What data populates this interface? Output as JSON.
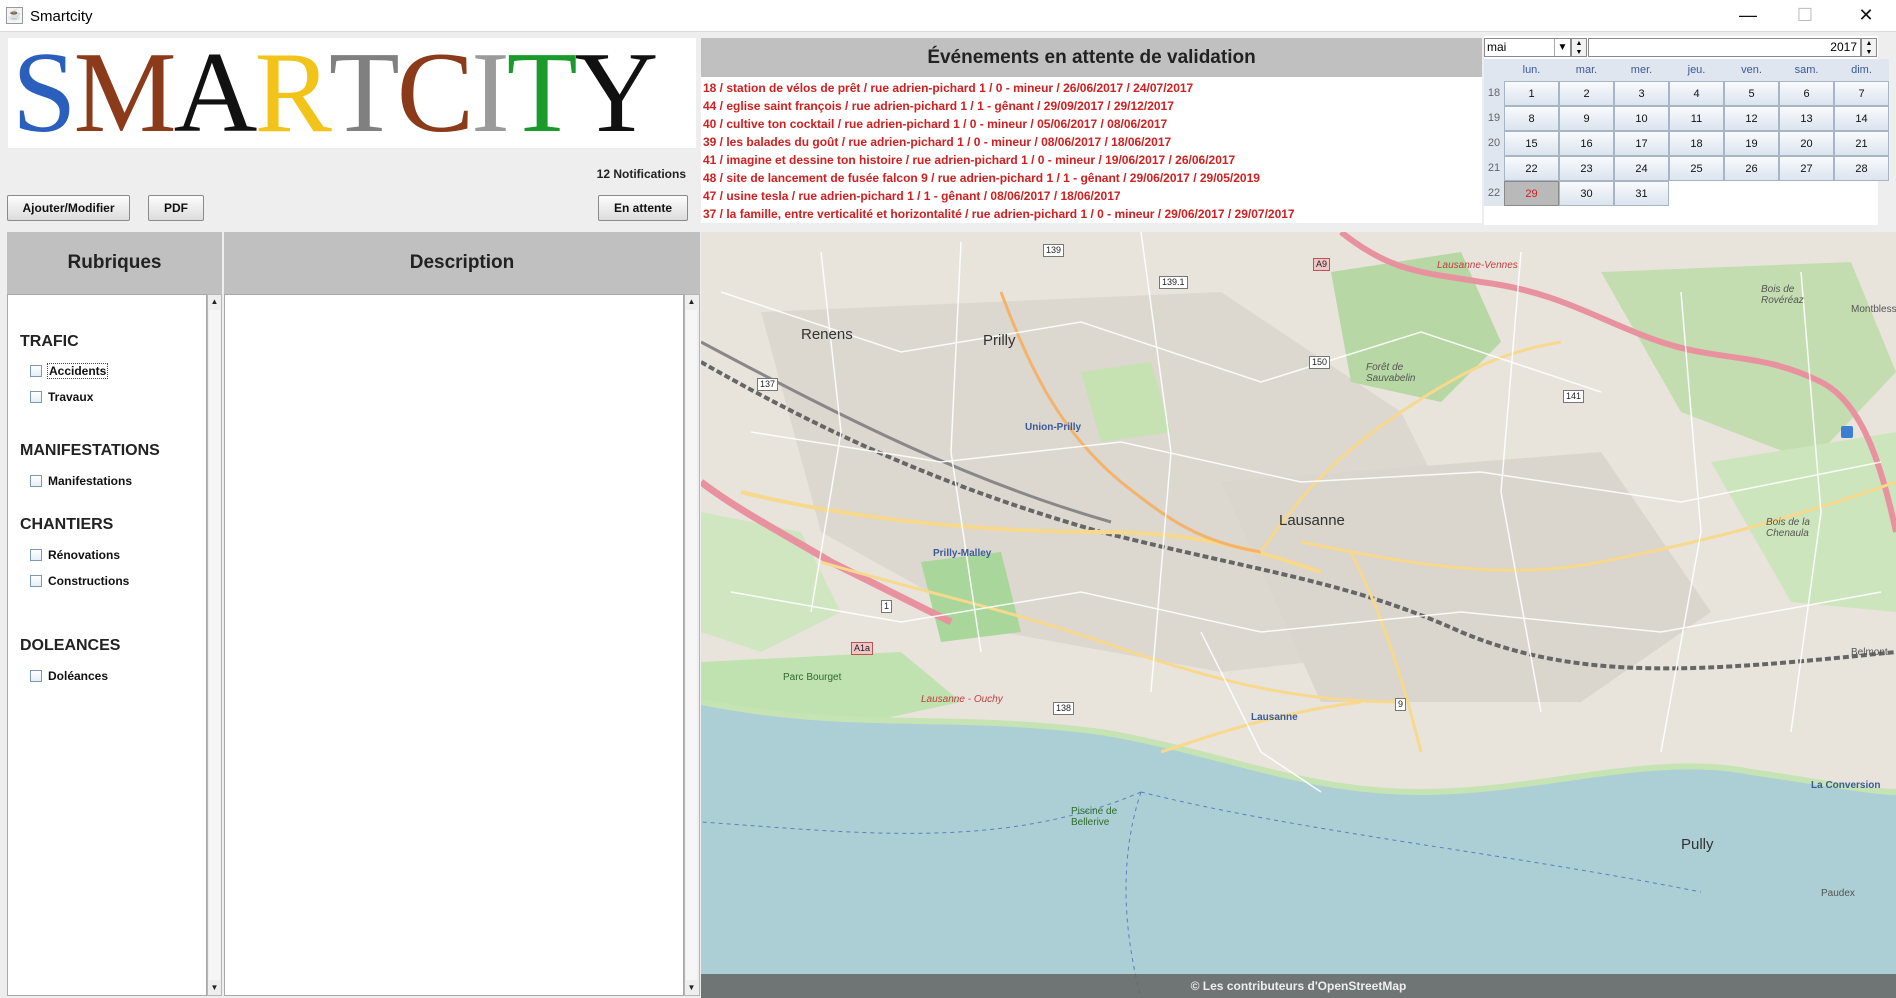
{
  "window": {
    "title": "Smartcity",
    "minimize_icon": "—",
    "maximize_icon": "☐",
    "close_icon": "✕"
  },
  "logo": {
    "letters": [
      {
        "char": "S",
        "color": "#2a5fbd"
      },
      {
        "char": "M",
        "color": "#8b3a1a"
      },
      {
        "char": "A",
        "color": "#111111"
      },
      {
        "char": "R",
        "color": "#f2c318"
      },
      {
        "char": "T",
        "color": "#808080"
      },
      {
        "char": "C",
        "color": "#8b3a1a"
      },
      {
        "char": "I",
        "color": "#9a9a9a"
      },
      {
        "char": "T",
        "color": "#1a9a2a"
      },
      {
        "char": "Y",
        "color": "#111111"
      }
    ]
  },
  "toolbar": {
    "notifications": "12 Notifications",
    "add_modify": "Ajouter/Modifier",
    "pdf": "PDF",
    "pending": "En attente"
  },
  "events": {
    "header": "Événements en attente de validation",
    "items": [
      "18 / station de vélos de prêt / rue adrien-pichard 1 / 0 - mineur / 26/06/2017 / 24/07/2017",
      "44 / eglise saint françois / rue adrien-pichard 1 / 1 - gênant / 29/09/2017 / 29/12/2017",
      "40 / cultive ton cocktail / rue adrien-pichard 1 / 0 - mineur / 05/06/2017 / 08/06/2017",
      "39 / les balades du goût  / rue adrien-pichard 1 / 0 - mineur / 08/06/2017 / 18/06/2017",
      "41 / imagine et dessine ton histoire / rue adrien-pichard 1 / 0 - mineur / 19/06/2017 / 26/06/2017",
      "48 / site de lancement de fusée falcon 9 / rue adrien-pichard 1 / 1 - gênant / 29/06/2017 / 29/05/2019",
      "47 / usine tesla / rue adrien-pichard 1 / 1 - gênant / 08/06/2017 / 18/06/2017",
      "37 / la famille, entre verticalité et horizontalité / rue adrien-pichard 1 / 0 - mineur / 29/06/2017 / 29/07/2017"
    ]
  },
  "calendar": {
    "month": "mai",
    "year": "2017",
    "weekdays": [
      "lun.",
      "mar.",
      "mer.",
      "jeu.",
      "ven.",
      "sam.",
      "dim."
    ],
    "weeks": [
      {
        "num": "18",
        "days": [
          "1",
          "2",
          "3",
          "4",
          "5",
          "6",
          "7"
        ]
      },
      {
        "num": "19",
        "days": [
          "8",
          "9",
          "10",
          "11",
          "12",
          "13",
          "14"
        ]
      },
      {
        "num": "20",
        "days": [
          "15",
          "16",
          "17",
          "18",
          "19",
          "20",
          "21"
        ]
      },
      {
        "num": "21",
        "days": [
          "22",
          "23",
          "24",
          "25",
          "26",
          "27",
          "28"
        ]
      },
      {
        "num": "22",
        "days": [
          "29",
          "30",
          "31",
          "",
          "",
          "",
          ""
        ]
      }
    ],
    "selected_day": "29"
  },
  "rubriques": {
    "header": "Rubriques",
    "sections": [
      {
        "title": "TRAFIC",
        "items": [
          "Accidents",
          "Travaux"
        ]
      },
      {
        "title": "MANIFESTATIONS",
        "items": [
          "Manifestations"
        ]
      },
      {
        "title": "CHANTIERS",
        "items": [
          "Rénovations",
          "Constructions"
        ]
      },
      {
        "title": "DOLEANCES",
        "items": [
          "Doléances"
        ]
      }
    ]
  },
  "description": {
    "header": "Description",
    "content": ""
  },
  "map": {
    "credit": "© Les contributeurs d'OpenStreetMap",
    "places": [
      "Renens",
      "Prilly",
      "Lausanne",
      "Pully",
      "Belmont",
      "Montbless",
      "Forêt de Sauvabelin",
      "Bois de la Chenaula",
      "Union-Prilly",
      "Prilly-Malley",
      "Lausanne",
      "La Conversion",
      "Parc Bourget",
      "Piscine de Bellerive",
      "Paudex",
      "Lausanne - Ouchy",
      "Lausanne-Vennes",
      "Bois de Rovéréaz"
    ],
    "routes": [
      "A9",
      "A1a",
      "137",
      "139",
      "139.1",
      "150",
      "1",
      "9",
      "138",
      "141"
    ]
  }
}
